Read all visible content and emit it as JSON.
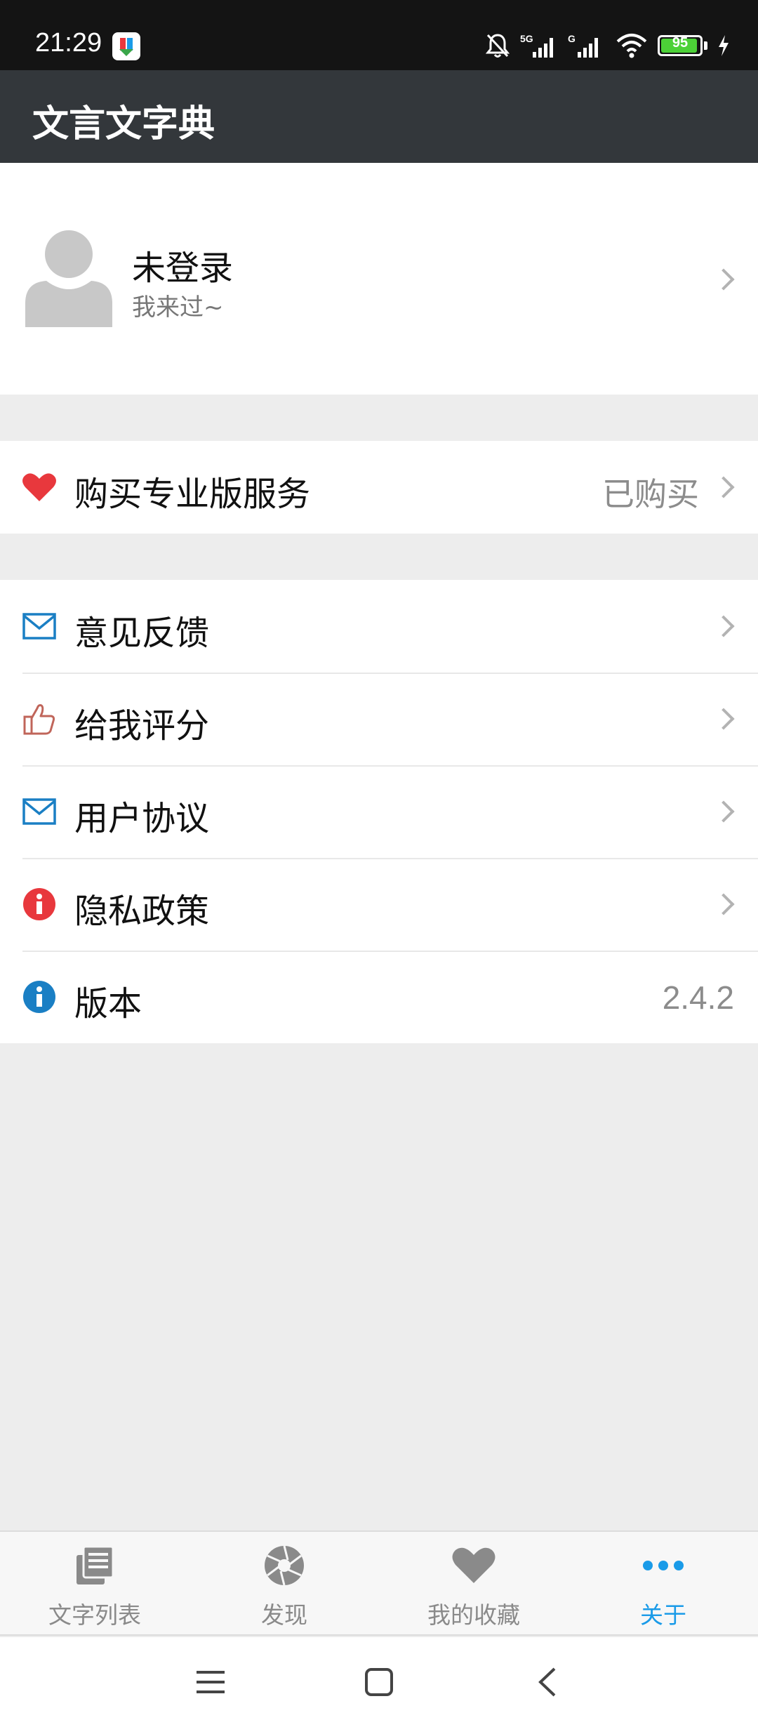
{
  "status_bar": {
    "time": "21:29",
    "battery": "95",
    "battery_level": 0.95,
    "icons": [
      "notifications-off-icon",
      "signal-5g-icon",
      "signal-g-icon",
      "wifi-icon",
      "battery-icon",
      "charging-icon"
    ]
  },
  "header": {
    "title": "文言文字典"
  },
  "profile": {
    "name": "未登录",
    "subtitle": "我来过~"
  },
  "purchase": {
    "label": "购买专业版服务",
    "value": "已购买",
    "icon": "heart-icon",
    "icon_color": "#e8383d"
  },
  "menu": {
    "feedback": {
      "label": "意见反馈",
      "icon": "mail-icon",
      "icon_color": "#1a7fc4"
    },
    "rate": {
      "label": "给我评分",
      "icon": "thumbs-up-icon",
      "icon_color": "#c0655a"
    },
    "agreement": {
      "label": "用户协议",
      "icon": "mail-icon",
      "icon_color": "#1a7fc4"
    },
    "privacy": {
      "label": "隐私政策",
      "icon": "info-icon",
      "icon_color": "#e8383d"
    },
    "version": {
      "label": "版本",
      "value": "2.4.2",
      "icon": "info-icon",
      "icon_color": "#1a7fc4"
    }
  },
  "tabs": [
    {
      "label": "文字列表",
      "icon": "list-icon"
    },
    {
      "label": "发现",
      "icon": "aperture-icon"
    },
    {
      "label": "我的收藏",
      "icon": "heart-icon"
    },
    {
      "label": "关于",
      "icon": "more-icon",
      "active": true
    }
  ],
  "colors": {
    "header_bg": "#33373b",
    "accent": "#1a9be8",
    "inactive": "#8a8a8a"
  }
}
